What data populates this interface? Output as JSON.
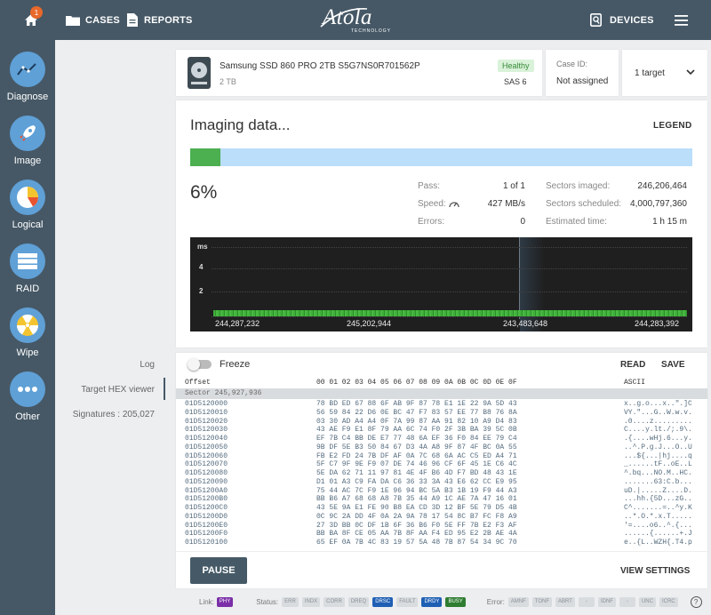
{
  "topbar": {
    "notif_count": "1",
    "cases": "CASES",
    "reports": "REPORTS",
    "logo": "Atola",
    "logo_sub": "TECHNOLOGY",
    "devices": "DEVICES"
  },
  "sidebar": {
    "items": [
      {
        "label": "Diagnose"
      },
      {
        "label": "Image"
      },
      {
        "label": "Logical"
      },
      {
        "label": "RAID"
      },
      {
        "label": "Wipe"
      },
      {
        "label": "Other"
      }
    ]
  },
  "leftpanel": {
    "log": "Log",
    "target": "Target HEX viewer",
    "signatures": "Signatures : 205,027"
  },
  "device": {
    "name": "Samsung SSD 860 PRO 2TB S5G7NS0R701562P",
    "size": "2 TB",
    "status": "Healthy",
    "interface": "SAS 6"
  },
  "case": {
    "label": "Case ID:",
    "value": "Not assigned"
  },
  "target": {
    "label": "1 target"
  },
  "imaging": {
    "title": "Imaging data...",
    "legend": "LEGEND",
    "percent": "6%",
    "progress": 0.06,
    "pass_label": "Pass:",
    "pass_value": "1 of 1",
    "speed_label": "Speed:",
    "speed_value": "427 MB/s",
    "errors_label": "Errors:",
    "errors_value": "0",
    "imaged_label": "Sectors imaged:",
    "imaged_value": "246,206,464",
    "scheduled_label": "Sectors scheduled:",
    "scheduled_value": "4,000,797,360",
    "estimated_label": "Estimated time:",
    "estimated_value": "1 h 15 m"
  },
  "graph": {
    "unit": "ms",
    "y1": "4",
    "y2": "2",
    "x_labels": [
      "244,287,232",
      "245,202,944",
      "243,483,648",
      "244,283,392"
    ]
  },
  "hexviewer": {
    "freeze": "Freeze",
    "read": "READ",
    "save": "SAVE",
    "offset_header": "Offset",
    "bytes_header": "00 01 02 03 04 05 06 07 08 09 0A 0B 0C 0D 0E 0F",
    "ascii_header": "ASCII",
    "sector": "Sector 245,927,936",
    "rows": [
      {
        "o": "01D5120000",
        "b": "78 BD ED 67 88 6F AB 9F 87 78 E1 1E 22 9A 5D 43",
        "a": "x..g.o...x..\".]C"
      },
      {
        "o": "01D5120010",
        "b": "56 59 84 22 D6 0E BC 47 F7 83 57 EE 77 B8 76 8A",
        "a": "VY.\"...G..W.w.v."
      },
      {
        "o": "01D5120020",
        "b": "03 30 AD A4 A4 0F 7A 99 87 AA 91 82 10 A9 D4 83",
        "a": ".0....z........."
      },
      {
        "o": "01D5120030",
        "b": "43 AE F9 E1 8F 79 AA 6C 74 F0 2F 3B BA 39 5C 0B",
        "a": "C....y.lt./;.9\\."
      },
      {
        "o": "01D5120040",
        "b": "EF 7B C4 BB DE E7 77 48 6A EF 36 F0 84 EE 79 C4",
        "a": ".{....wHj.6...y."
      },
      {
        "o": "01D5120050",
        "b": "9B DF 5E B3 50 84 67 D3 4A A8 9F 87 4F BC 0A 55",
        "a": "..^.P.g.J...O..U"
      },
      {
        "o": "01D5120060",
        "b": "FB E2 FD 24 7B DF AF 0A 7C 68 6A AC C5 ED A4 71",
        "a": "...${...|hj....q"
      },
      {
        "o": "01D5120070",
        "b": "5F C7 9F 9E F9 07 DE 74 46 96 CF 6F 45 1E C6 4C",
        "a": "_......tF..oE..L"
      },
      {
        "o": "01D5120080",
        "b": "5E DA 62 71 11 97 81 4E 4F B6 4D F7 BD 48 43 1E",
        "a": "^.bq...NO.M..HC."
      },
      {
        "o": "01D5120090",
        "b": "D1 01 A3 C9 FA DA C6 36 33 3A 43 E6 62 CC E9 95",
        "a": ".......63:C.b..."
      },
      {
        "o": "01D51200A0",
        "b": "75 44 AC 7C F9 1E 96 94 BC 5A B3 1B 19 F9 44 A3",
        "a": "uD.|.....Z....D."
      },
      {
        "o": "01D51200B0",
        "b": "BB B6 A7 68 68 A8 7B 35 44 A9 1C AE 7A 47 16 01",
        "a": "...hh.{5D...zG.."
      },
      {
        "o": "01D51200C0",
        "b": "43 5E 9A E1 FE 90 B8 EA CD 3D 12 BF 5E 79 D5 4B",
        "a": "C^.......=..^y.K"
      },
      {
        "o": "01D51200D0",
        "b": "0C 9C 2A DD 4F 0A 2A 9A 78 17 54 8C B7 FC F8 A9",
        "a": "..*.O.*.x.T....."
      },
      {
        "o": "01D51200E0",
        "b": "27 3D BB 0C DF 1B 6F 36 B6 F0 5E FF 7B E2 F3 AF",
        "a": "'=....o6..^.{..."
      },
      {
        "o": "01D51200F0",
        "b": "BB BA 8F CE 05 AA 7B 8F AA F4 ED 95 E2 2B AE 4A",
        "a": "......{......+.J"
      },
      {
        "o": "01D5120100",
        "b": "65 EF 0A 7B 4C 83 19 57 5A 48 7B 87 54 34 9C 70",
        "a": "e..{L..WZH{.T4.p"
      }
    ]
  },
  "bottom": {
    "pause": "PAUSE",
    "view_settings": "VIEW SETTINGS"
  },
  "statusbar": {
    "link_label": "Link:",
    "link_value": "PHY",
    "status_label": "Status:",
    "status_items": [
      "ERR",
      "INDX",
      "CORR",
      "DREQ",
      "DRSC",
      "FAULT",
      "DRDY",
      "BUSY"
    ],
    "error_label": "Error:",
    "error_items": [
      "AMNF",
      "TONF",
      "ABRT",
      "-",
      "IDNF",
      "-",
      "UNC",
      "ICRC"
    ],
    "help": "?"
  },
  "colors": {
    "topbar": "#465866",
    "accent": "#4caf50",
    "progress_bg": "#bbdefb",
    "healthy": "#d9f2d9",
    "phy": "#7b2fa8",
    "drsc": "#1e5fb4",
    "drdy": "#1e5fb4",
    "busy": "#2e7d32"
  }
}
